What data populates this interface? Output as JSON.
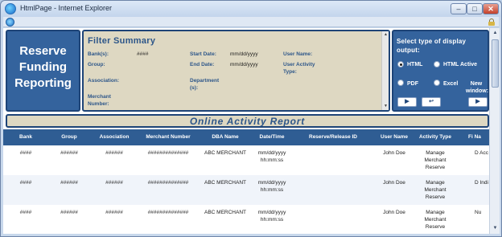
{
  "window": {
    "title": "HtmlPage - Internet Explorer",
    "min": "–",
    "max": "□",
    "close": "✕"
  },
  "brand": {
    "line1": "Reserve",
    "line2": "Funding",
    "line3": "Reporting"
  },
  "filter": {
    "title": "Filter Summary",
    "bank_label": "Bank(s):",
    "bank_value": "####",
    "group_label": "Group:",
    "association_label": "Association:",
    "merchant_label": "Merchant Number:",
    "start_label": "Start Date:",
    "start_value": "mm/dd/yyyy",
    "end_label": "End Date:",
    "end_value": "mm/dd/yyyy",
    "department_label": "Department (s):",
    "user_label": "User Name:",
    "activity_label": "User Activity Type:"
  },
  "display": {
    "title": "Select type of display output:",
    "options": [
      {
        "label": "HTML",
        "selected": true
      },
      {
        "label": "HTML Active",
        "selected": false
      },
      {
        "label": "PDF",
        "selected": false
      },
      {
        "label": "Excel",
        "selected": false
      }
    ],
    "new_window": "New window:",
    "buttons": [
      "▶",
      "↩",
      "▶"
    ]
  },
  "report": {
    "title": "Online Activity Report"
  },
  "table": {
    "headers": [
      "Bank",
      "Group",
      "Association",
      "Merchant Number",
      "DBA Name",
      "Date/Time",
      "Reserve/Release ID",
      "User Name",
      "Activity Type",
      "Fi Na"
    ],
    "rows": [
      {
        "bank": "####",
        "group": "######",
        "association": "######",
        "merchant": "##############",
        "dba": "ABC MERCHANT",
        "datetime": "mm/dd/yyyy hh:mm:ss",
        "id": "",
        "user": "John Doe",
        "activity": "Manage Merchant Reserve",
        "field": "D Acc"
      },
      {
        "bank": "####",
        "group": "######",
        "association": "######",
        "merchant": "##############",
        "dba": "ABC MERCHANT",
        "datetime": "mm/dd/yyyy hh:mm:ss",
        "id": "",
        "user": "John Doe",
        "activity": "Manage Merchant Reserve",
        "field": "D Indi"
      },
      {
        "bank": "####",
        "group": "######",
        "association": "######",
        "merchant": "##############",
        "dba": "ABC MERCHANT",
        "datetime": "mm/dd/yyyy hh:mm:ss",
        "id": "",
        "user": "John Doe",
        "activity": "Manage Merchant Reserve",
        "field": "Nu"
      }
    ]
  }
}
